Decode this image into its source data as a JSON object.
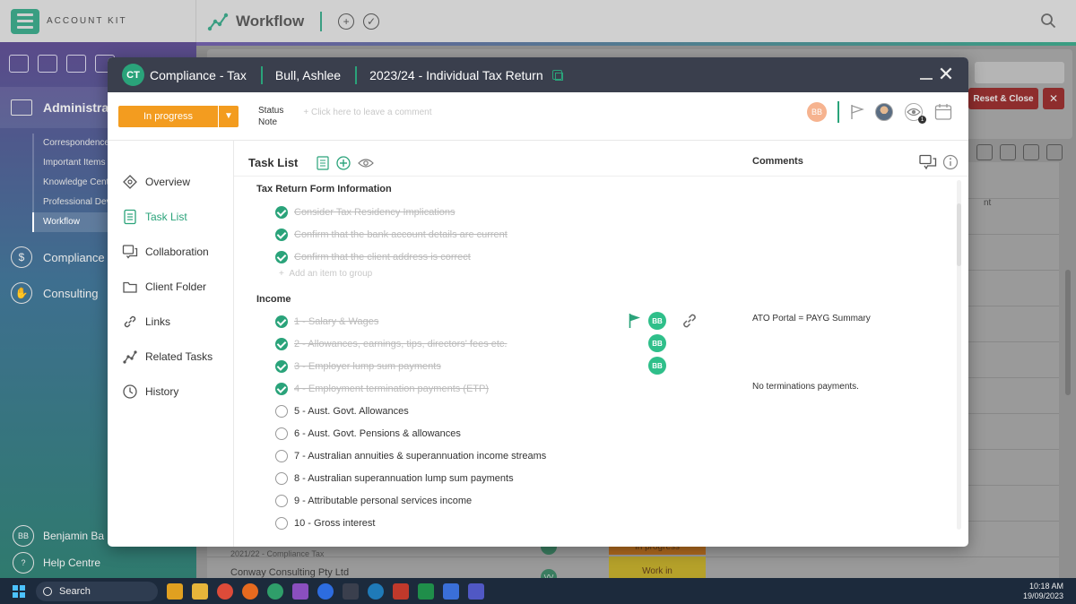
{
  "app": {
    "brand": "ACCOUNT KIT",
    "module_title": "Workflow",
    "accent_color": "#2aa37a"
  },
  "sidebar": {
    "admin_label": "Administrat",
    "admin_items": [
      "Correspondence",
      "Important Items",
      "Knowledge Centre",
      "Professional Development",
      "Workflow"
    ],
    "sections": [
      "Compliance",
      "Consulting"
    ],
    "user_initials": "BB",
    "user_name": "Benjamin Ba",
    "help": "Help Centre"
  },
  "background": {
    "reset_label": "Reset & Close",
    "column_entry": "nt",
    "rows": [
      {
        "sub": "2021/22 - Compliance Tax",
        "initials": "",
        "status": "In progress"
      },
      {
        "name": "Conway Consulting Pty Ltd",
        "initials": "VV",
        "status": "Work in"
      }
    ]
  },
  "taskbar": {
    "search": "Search",
    "time": "10:18 AM",
    "date": "19/09/2023"
  },
  "modal": {
    "badge": "CT",
    "category": "Compliance - Tax",
    "client": "Bull, Ashlee",
    "job": "2023/24 - Individual Tax Return",
    "status_value": "In progress",
    "status_label": "Status",
    "note_label": "Note",
    "comment_placeholder": "Click here to leave a comment",
    "assignee_initials": "BB",
    "watch_count": "1",
    "status_color": "#f39c1f"
  },
  "nav": {
    "items": [
      "Overview",
      "Task List",
      "Collaboration",
      "Client Folder",
      "Links",
      "Related Tasks",
      "History"
    ]
  },
  "tasklist": {
    "title": "Task List",
    "comments_header": "Comments",
    "groups": [
      {
        "title": "Tax Return Form Information",
        "tasks": [
          {
            "text": "Consider Tax Residency Implications",
            "done": true
          },
          {
            "text": "Confirm that the bank account details are current",
            "done": true
          },
          {
            "text": "Confirm that the client address is correct",
            "done": true
          }
        ],
        "add_item": "Add an item to group"
      },
      {
        "title": "Income",
        "tasks": [
          {
            "text": "1 - Salary & Wages",
            "done": true,
            "assignee": "BB",
            "comment": "ATO Portal = PAYG Summary"
          },
          {
            "text": "2 - Allowances, earnings, tips, directors' fees etc.",
            "done": true,
            "assignee": "BB"
          },
          {
            "text": "3 - Employer lump sum payments",
            "done": true,
            "assignee": "BB"
          },
          {
            "text": "4 - Employment termination payments (ETP)",
            "done": true,
            "comment": "No terminations payments."
          },
          {
            "text": "5 - Aust. Govt. Allowances",
            "done": false
          },
          {
            "text": "6 - Aust. Govt. Pensions & allowances",
            "done": false
          },
          {
            "text": "7 - Australian annuities & superannuation income streams",
            "done": false
          },
          {
            "text": "8 - Australian superannuation lump sum payments",
            "done": false
          },
          {
            "text": "9 - Attributable personal services income",
            "done": false
          },
          {
            "text": "10 - Gross interest",
            "done": false
          }
        ]
      }
    ]
  }
}
